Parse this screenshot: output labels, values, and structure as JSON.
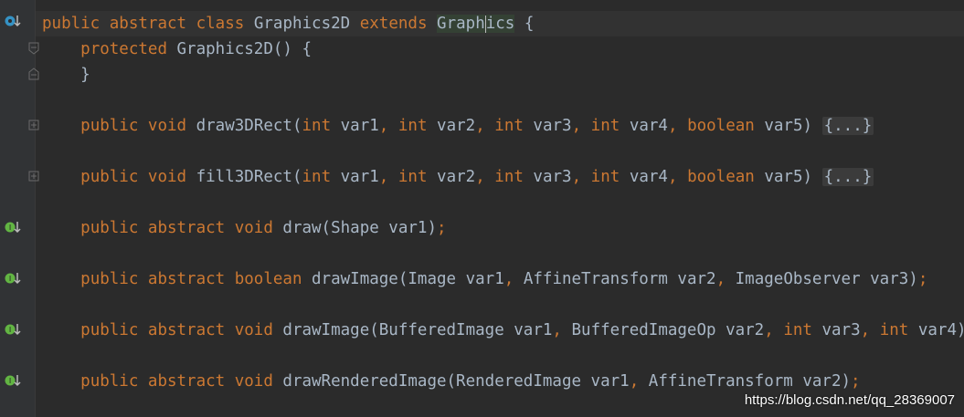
{
  "lines": [
    {
      "tokens": [
        [
          "kw",
          "public"
        ],
        [
          "id",
          " "
        ],
        [
          "kw",
          "abstract"
        ],
        [
          "id",
          " "
        ],
        [
          "kw",
          "class"
        ],
        [
          "id",
          " Graphics2D "
        ],
        [
          "kw",
          "extends"
        ],
        [
          "id",
          " "
        ],
        [
          "hl",
          "Graph"
        ],
        [
          "hl2",
          "ics"
        ],
        [
          "id",
          " {"
        ]
      ]
    },
    {
      "tokens": [
        [
          "id",
          "    "
        ],
        [
          "kw",
          "protected"
        ],
        [
          "id",
          " Graphics2D() {"
        ]
      ]
    },
    {
      "tokens": [
        [
          "id",
          "    }"
        ]
      ]
    },
    {
      "tokens": [
        [
          "id",
          ""
        ]
      ]
    },
    {
      "tokens": [
        [
          "id",
          "    "
        ],
        [
          "kw",
          "public void"
        ],
        [
          "id",
          " draw3DRect("
        ],
        [
          "kw",
          "int"
        ],
        [
          "id",
          " var1"
        ],
        [
          "p",
          ","
        ],
        [
          "id",
          " "
        ],
        [
          "kw",
          "int"
        ],
        [
          "id",
          " var2"
        ],
        [
          "p",
          ","
        ],
        [
          "id",
          " "
        ],
        [
          "kw",
          "int"
        ],
        [
          "id",
          " var3"
        ],
        [
          "p",
          ","
        ],
        [
          "id",
          " "
        ],
        [
          "kw",
          "int"
        ],
        [
          "id",
          " var4"
        ],
        [
          "p",
          ","
        ],
        [
          "id",
          " "
        ],
        [
          "kw",
          "boolean"
        ],
        [
          "id",
          " var5) "
        ],
        [
          "fold",
          "{...}"
        ]
      ]
    },
    {
      "tokens": [
        [
          "id",
          ""
        ]
      ]
    },
    {
      "tokens": [
        [
          "id",
          "    "
        ],
        [
          "kw",
          "public void"
        ],
        [
          "id",
          " fill3DRect("
        ],
        [
          "kw",
          "int"
        ],
        [
          "id",
          " var1"
        ],
        [
          "p",
          ","
        ],
        [
          "id",
          " "
        ],
        [
          "kw",
          "int"
        ],
        [
          "id",
          " var2"
        ],
        [
          "p",
          ","
        ],
        [
          "id",
          " "
        ],
        [
          "kw",
          "int"
        ],
        [
          "id",
          " var3"
        ],
        [
          "p",
          ","
        ],
        [
          "id",
          " "
        ],
        [
          "kw",
          "int"
        ],
        [
          "id",
          " var4"
        ],
        [
          "p",
          ","
        ],
        [
          "id",
          " "
        ],
        [
          "kw",
          "boolean"
        ],
        [
          "id",
          " var5) "
        ],
        [
          "fold",
          "{...}"
        ]
      ]
    },
    {
      "tokens": [
        [
          "id",
          ""
        ]
      ]
    },
    {
      "tokens": [
        [
          "id",
          "    "
        ],
        [
          "kw",
          "public abstract void"
        ],
        [
          "id",
          " draw(Shape var1)"
        ],
        [
          "p",
          ";"
        ]
      ]
    },
    {
      "tokens": [
        [
          "id",
          ""
        ]
      ]
    },
    {
      "tokens": [
        [
          "id",
          "    "
        ],
        [
          "kw",
          "public abstract boolean"
        ],
        [
          "id",
          " drawImage(Image var1"
        ],
        [
          "p",
          ","
        ],
        [
          "id",
          " AffineTransform var2"
        ],
        [
          "p",
          ","
        ],
        [
          "id",
          " ImageObserver var3)"
        ],
        [
          "p",
          ";"
        ]
      ]
    },
    {
      "tokens": [
        [
          "id",
          ""
        ]
      ]
    },
    {
      "tokens": [
        [
          "id",
          "    "
        ],
        [
          "kw",
          "public abstract void"
        ],
        [
          "id",
          " drawImage(BufferedImage var1"
        ],
        [
          "p",
          ","
        ],
        [
          "id",
          " BufferedImageOp var2"
        ],
        [
          "p",
          ","
        ],
        [
          "id",
          " "
        ],
        [
          "kw",
          "int"
        ],
        [
          "id",
          " var3"
        ],
        [
          "p",
          ","
        ],
        [
          "id",
          " "
        ],
        [
          "kw",
          "int"
        ],
        [
          "id",
          " var4)"
        ],
        [
          "p",
          ";"
        ]
      ]
    },
    {
      "tokens": [
        [
          "id",
          ""
        ]
      ]
    },
    {
      "tokens": [
        [
          "id",
          "    "
        ],
        [
          "kw",
          "public abstract void"
        ],
        [
          "id",
          " drawRenderedImage(RenderedImage var1"
        ],
        [
          "p",
          ","
        ],
        [
          "id",
          " AffineTransform var2)"
        ],
        [
          "p",
          ";"
        ]
      ]
    }
  ],
  "gutter_icons": {
    "implemented": "overrides-icon",
    "implemented_abstract": "implemented-abstract-icon",
    "fold": "fold-icon"
  },
  "watermark": "https://blog.csdn.net/qq_28369007"
}
